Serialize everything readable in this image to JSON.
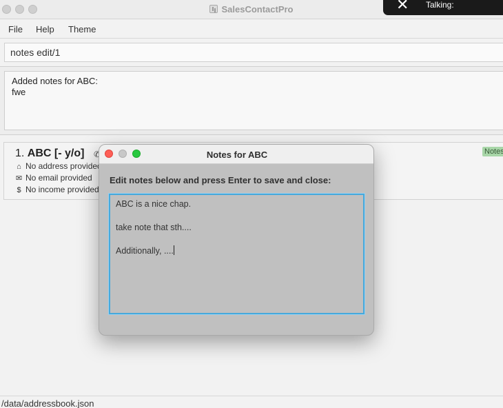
{
  "window": {
    "title": "SalesContactPro",
    "controls": [
      "close",
      "minimize",
      "zoom"
    ]
  },
  "notification": {
    "text": "Talking:",
    "icon": "close-icon"
  },
  "menu": {
    "items": [
      "File",
      "Help",
      "Theme"
    ]
  },
  "command": {
    "value": "notes edit/1"
  },
  "result": {
    "lines": [
      "Added notes for ABC:",
      "fwe"
    ]
  },
  "contacts": [
    {
      "index": "1.",
      "name": "ABC [- y/o]",
      "phone_icon": "phone-icon",
      "address": "No address provided",
      "email": "No email provided",
      "income": "No income provided",
      "tag": "Notes"
    }
  ],
  "status": {
    "path": "/data/addressbook.json"
  },
  "dialog": {
    "title": "Notes for ABC",
    "prompt": "Edit notes below and press Enter to save and close:",
    "notes_lines": [
      "ABC is a nice chap.",
      "",
      "take note that sth....",
      "",
      "Additionally, ...."
    ],
    "colors": {
      "close": "#fe5f57",
      "minimize": "#c8c8c8",
      "zoom": "#28c840",
      "focus_ring": "#46a9dc"
    }
  }
}
